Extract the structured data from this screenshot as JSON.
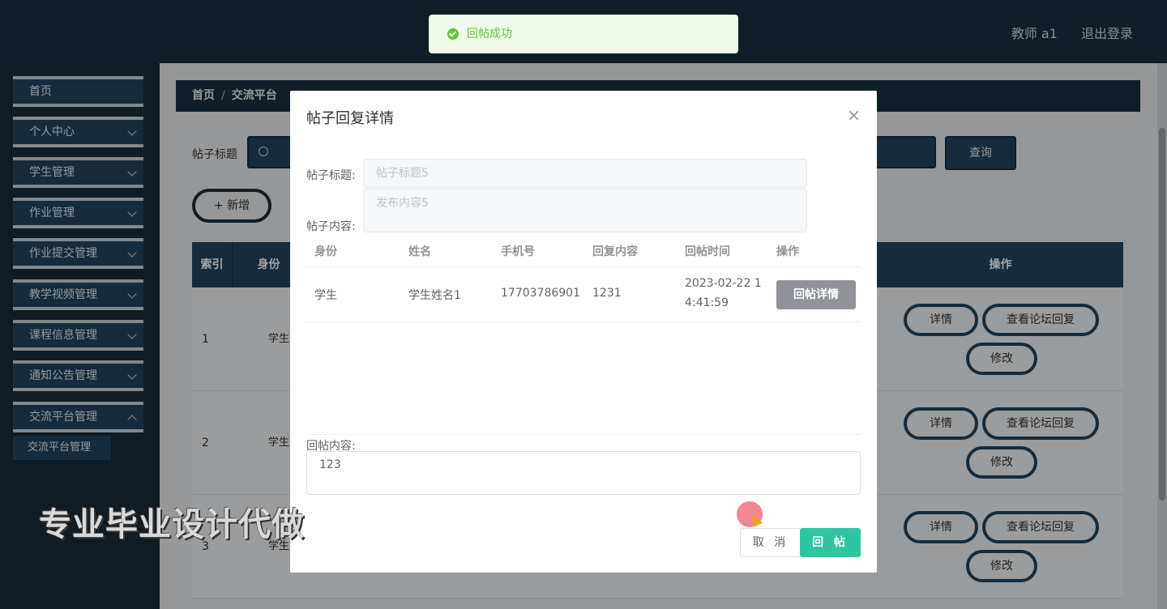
{
  "header": {
    "user_label": "教师 a1",
    "logout_label": "退出登录"
  },
  "sidebar": {
    "items": [
      {
        "label": "首页"
      },
      {
        "label": "个人中心"
      },
      {
        "label": "学生管理"
      },
      {
        "label": "作业管理"
      },
      {
        "label": "作业提交管理"
      },
      {
        "label": "教学视频管理"
      },
      {
        "label": "课程信息管理"
      },
      {
        "label": "通知公告管理"
      },
      {
        "label": "交流平台管理"
      }
    ],
    "submenu": {
      "label": "交流平台管理"
    }
  },
  "breadcrumb": {
    "home": "首页",
    "separator": "/",
    "current": "交流平台"
  },
  "search": {
    "label": "帖子标题",
    "button_label": "查询"
  },
  "add_button_label": "+ 新增",
  "table": {
    "headers": {
      "index": "索引",
      "role": "身份",
      "actions": "操作"
    },
    "rows": [
      {
        "index": "1",
        "role": "学生"
      },
      {
        "index": "2",
        "role": "学生"
      },
      {
        "index": "3",
        "role": "学生"
      }
    ],
    "action_labels": {
      "detail": "详情",
      "view_replies": "查看论坛回复",
      "edit": "修改"
    }
  },
  "dialog": {
    "title": "帖子回复详情",
    "close_icon": "×",
    "post_title_label": "帖子标题:",
    "post_title_value": "帖子标题5",
    "post_content_label": "帖子内容:",
    "post_content_value": "发布内容5",
    "columns": [
      "身份",
      "姓名",
      "手机号",
      "回复内容",
      "回帖时间",
      "操作"
    ],
    "row": {
      "role": "学生",
      "name": "学生姓名1",
      "phone": "17703786901",
      "content": "1231",
      "time_line1": "2023-02-22 1",
      "time_line2": "4:41:59",
      "action": "回帖详情"
    },
    "reply_label": "回帖内容:",
    "reply_value": "123",
    "cancel_label": "取 消",
    "submit_label": "回 帖"
  },
  "toast": {
    "message": "回帖成功",
    "color": "#67c23a"
  },
  "watermark": "专业毕业设计代做",
  "colors": {
    "sidebar": "#23445f",
    "header": "#1a2f3d",
    "accent": "#2fc5a0"
  }
}
